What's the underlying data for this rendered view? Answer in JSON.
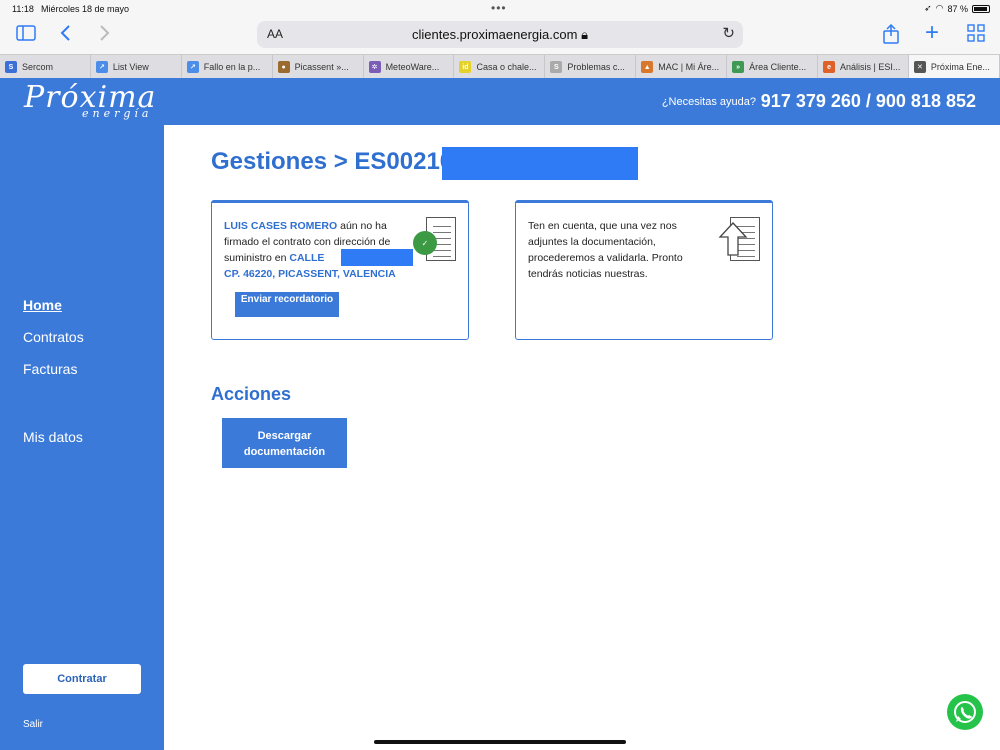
{
  "status_bar": {
    "time": "11:18",
    "date": "Miércoles 18 de mayo",
    "battery": "87 %"
  },
  "browser": {
    "aa_label": "AA",
    "url": "clientes.proximaenergia.com",
    "tabs": [
      {
        "label": "Sercom",
        "color": "#3a6fd8",
        "glyph": "S"
      },
      {
        "label": "List View",
        "color": "#4b8de8",
        "glyph": "↗"
      },
      {
        "label": "Fallo en la p...",
        "color": "#4b8de8",
        "glyph": "↗"
      },
      {
        "label": "Picassent »...",
        "color": "#9a6a2e",
        "glyph": "●"
      },
      {
        "label": "MeteoWare...",
        "color": "#7b5db8",
        "glyph": "✲"
      },
      {
        "label": "Casa o chale...",
        "color": "#e4d22a",
        "glyph": "id"
      },
      {
        "label": "Problemas c...",
        "color": "#aaaaaa",
        "glyph": "S"
      },
      {
        "label": "MAC | Mi Áre...",
        "color": "#d9772a",
        "glyph": "▲"
      },
      {
        "label": "Área Cliente...",
        "color": "#3c9a55",
        "glyph": "»"
      },
      {
        "label": "Análisis | ESI...",
        "color": "#e0602a",
        "glyph": "e"
      },
      {
        "label": "Próxima Ene...",
        "color": "#555555",
        "glyph": "✕"
      }
    ]
  },
  "header": {
    "logo": "Próxima",
    "logo_sub": "energía",
    "help_text": "¿Necesitas ayuda?",
    "phones": "917 379 260 / 900 818 852"
  },
  "sidebar": {
    "items": [
      "Home",
      "Contratos",
      "Facturas",
      "Mis datos"
    ],
    "cta": "Contratar",
    "logout": "Salir"
  },
  "main": {
    "title": "Gestiones > ES00210",
    "card1": {
      "name": "LUIS CASES ROMERO",
      "text1": " aún no ha firmado el contrato con dirección de suministro en ",
      "street": "CALLE",
      "city": "CP. 46220, PICASSENT, VALENCIA",
      "button": "Enviar recordatorio"
    },
    "card2": {
      "text": "Ten en cuenta, que una vez nos adjuntes la documentación, procederemos a validarla. Pronto tendrás noticias nuestras."
    },
    "actions_title": "Acciones",
    "download_button": "Descargar documentación"
  }
}
